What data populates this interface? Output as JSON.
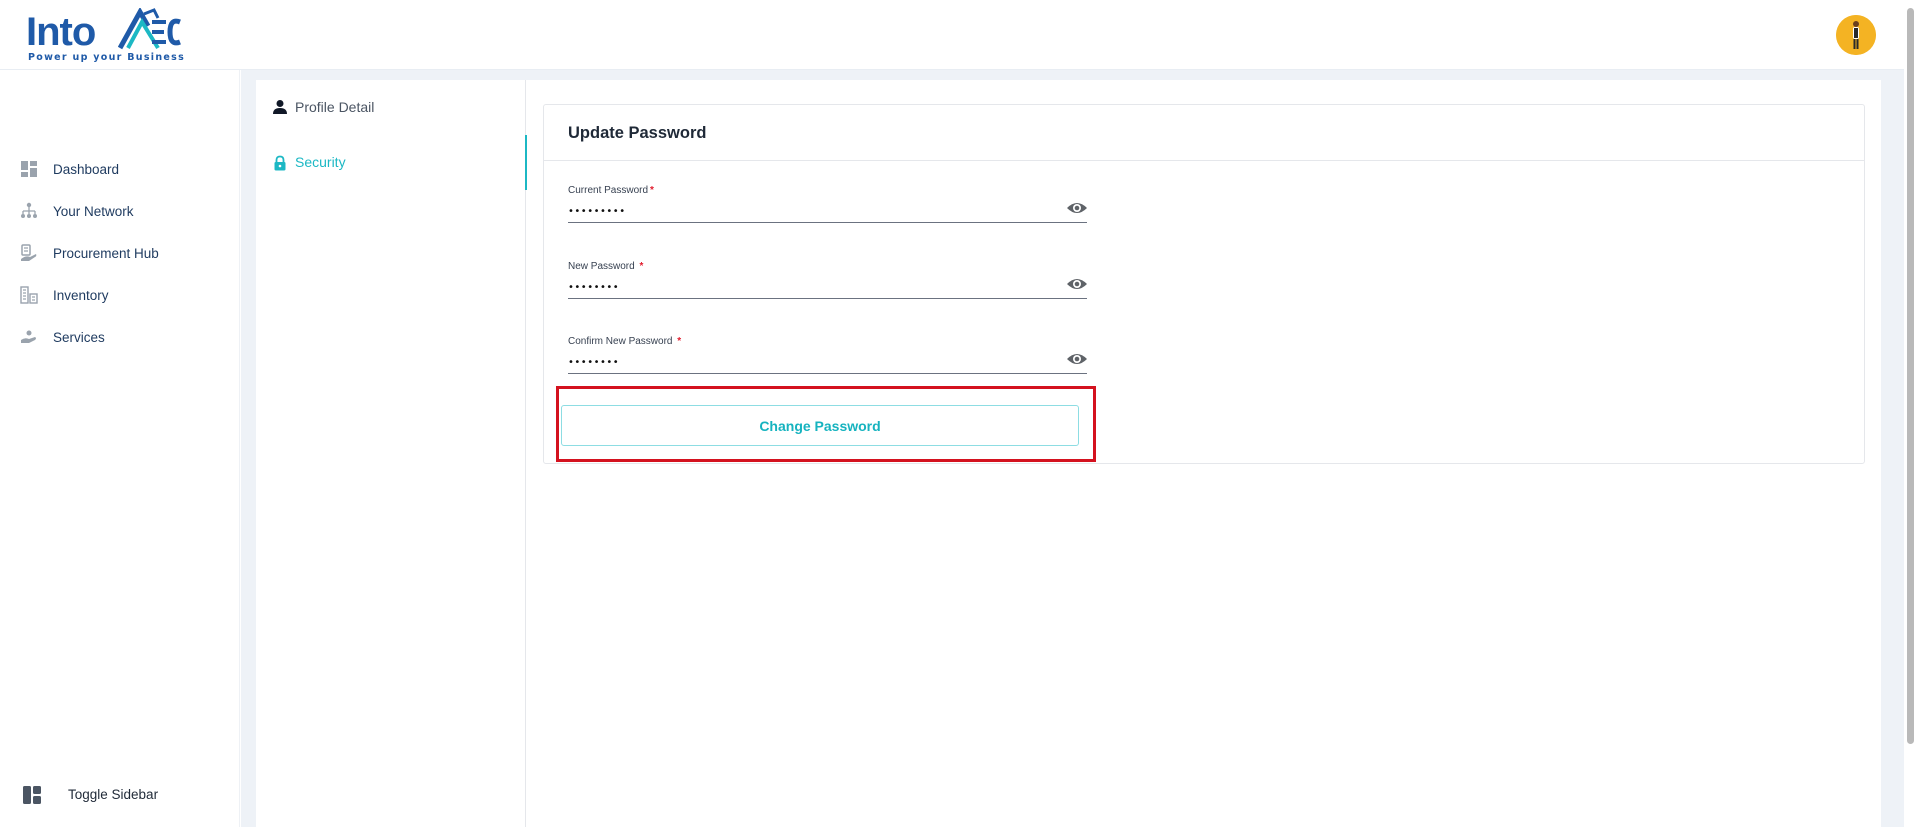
{
  "brand": {
    "name": "IntoAEC",
    "name_part1": "Into",
    "tagline": "Power up your Business",
    "primary_color": "#1f5aa8",
    "accent_color": "#1cb8c4"
  },
  "header": {
    "avatar_icon": "user-avatar"
  },
  "sidebar": {
    "items": [
      {
        "label": "Dashboard",
        "icon": "dashboard-icon"
      },
      {
        "label": "Your Network",
        "icon": "network-icon"
      },
      {
        "label": "Procurement Hub",
        "icon": "procurement-icon"
      },
      {
        "label": "Inventory",
        "icon": "inventory-icon"
      },
      {
        "label": "Services",
        "icon": "services-icon"
      }
    ],
    "toggle_label": "Toggle Sidebar"
  },
  "settings_nav": {
    "items": [
      {
        "label": "Profile Detail",
        "icon": "person-icon",
        "active": false
      },
      {
        "label": "Security",
        "icon": "lock-icon",
        "active": true
      }
    ]
  },
  "update_password": {
    "title": "Update Password",
    "fields": [
      {
        "label": "Current Password",
        "required": true,
        "value": "•••••••••"
      },
      {
        "label": "New Password",
        "required": true,
        "value": "••••••••"
      },
      {
        "label": "Confirm New Password",
        "required": true,
        "value": "••••••••"
      }
    ],
    "submit_label": "Change Password",
    "highlight_color": "#d4121f"
  }
}
